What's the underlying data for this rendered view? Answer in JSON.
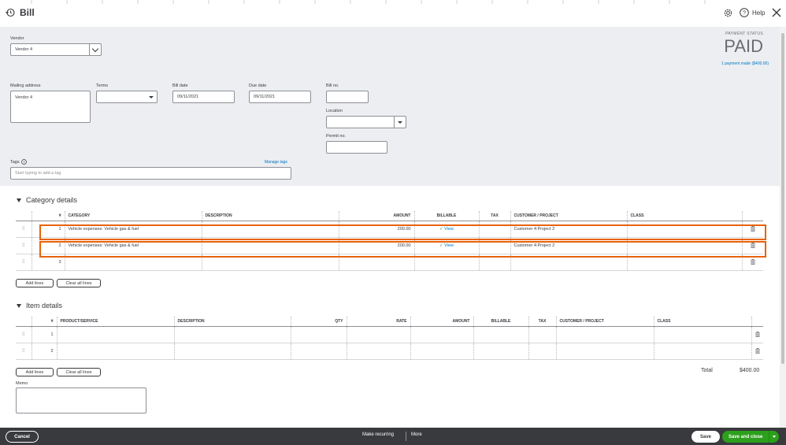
{
  "app": {
    "title": "Bill",
    "help": "Help"
  },
  "vendor": {
    "label": "Vendor",
    "value": "Vendor 4"
  },
  "payment": {
    "status_label": "PAYMENT STATUS",
    "status": "PAID",
    "link": "1 payment made ($400.00)"
  },
  "form": {
    "mailing_address_label": "Mailing address",
    "mailing_address": "Vendor 4",
    "terms_label": "Terms",
    "terms_value": "",
    "bill_date_label": "Bill date",
    "bill_date": "09/11/2021",
    "due_date_label": "Due date",
    "due_date": "09/11/2021",
    "bill_no_label": "Bill no.",
    "bill_no": "",
    "location_label": "Location",
    "location": "",
    "permit_label": "Permit no.",
    "permit": "",
    "tags_label": "Tags",
    "tags_placeholder": "Start typing to add a tag",
    "manage_tags": "Manage tags"
  },
  "category": {
    "title": "Category details",
    "headers": [
      "#",
      "CATEGORY",
      "DESCRIPTION",
      "AMOUNT",
      "BILLABLE",
      "TAX",
      "CUSTOMER / PROJECT",
      "CLASS"
    ],
    "rows": [
      {
        "num": "1",
        "category": "Vehicle expenses: Vehicle gas & fuel",
        "description": "",
        "amount": "200.00",
        "billable": "View",
        "customer": "Customer 4:Project 2"
      },
      {
        "num": "2",
        "category": "Vehicle expenses: Vehicle gas & fuel",
        "description": "",
        "amount": "200.00",
        "billable": "View",
        "customer": "Customer 4:Project 2"
      },
      {
        "num": "3",
        "category": "",
        "description": "",
        "amount": "",
        "billable": "",
        "customer": ""
      }
    ],
    "add_lines": "Add lines",
    "clear_lines": "Clear all lines"
  },
  "items": {
    "title": "Item details",
    "headers": [
      "#",
      "PRODUCT/SERVICE",
      "DESCRIPTION",
      "QTY",
      "RATE",
      "AMOUNT",
      "BILLABLE",
      "TAX",
      "CUSTOMER / PROJECT",
      "CLASS"
    ],
    "rows": [
      {
        "num": "1"
      },
      {
        "num": "2"
      }
    ],
    "add_lines": "Add lines",
    "clear_lines": "Clear all lines"
  },
  "total": {
    "label": "Total",
    "value": "$400.00"
  },
  "memo": {
    "label": "Memo"
  },
  "footer": {
    "cancel": "Cancel",
    "make_recurring": "Make recurring",
    "more": "More",
    "save": "Save",
    "save_close": "Save and close"
  },
  "colors": {
    "accent": "#2ca01c",
    "link": "#0077c5",
    "highlight": "#e8620c",
    "footer": "#393a3d"
  }
}
